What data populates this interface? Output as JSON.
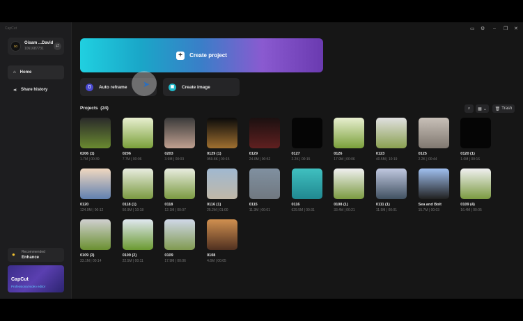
{
  "app": {
    "title": "CapCut"
  },
  "user": {
    "name": "Oisam ...David",
    "id": "1061687731"
  },
  "nav": [
    {
      "label": "Home",
      "icon": "home-icon"
    },
    {
      "label": "Share history",
      "icon": "share-icon"
    }
  ],
  "recommended": {
    "label": "Recommended",
    "item": "Enhance"
  },
  "promo": {
    "title": "CapCut",
    "subtitle": "Professional video editor"
  },
  "create_project": "Create project",
  "tools": [
    {
      "label": "Auto reframe",
      "color": "#4a4ad0"
    },
    {
      "label": "Create image",
      "color": "#20b8c8"
    }
  ],
  "projects": {
    "title": "Projects",
    "count": "(24)",
    "trash": "Trash"
  },
  "items": [
    {
      "t": "0206 (1)",
      "m": "1.7M | 00:39",
      "c1": "#2a2a2a",
      "c2": "#6a8a30"
    },
    {
      "t": "0206",
      "m": "7.7M | 00:06",
      "c1": "#e8efd0",
      "c2": "#7aa03a"
    },
    {
      "t": "0203",
      "m": "3.9M | 00:03",
      "c1": "#3a3a3a",
      "c2": "#c0a090"
    },
    {
      "t": "0129 (1)",
      "m": "959.8K | 00:15",
      "c1": "#0a0a0a",
      "c2": "#a07030"
    },
    {
      "t": "0129",
      "m": "24.0M | 00:52",
      "c1": "#1a1010",
      "c2": "#602020"
    },
    {
      "t": "0127",
      "m": "2.2K | 00:15",
      "c1": "#050505",
      "c2": "#050505"
    },
    {
      "t": "0126",
      "m": "17.9M | 00:06",
      "c1": "#e8efd0",
      "c2": "#7aa03a"
    },
    {
      "t": "0123",
      "m": "40.5M | 10:19",
      "c1": "#e0e0e0",
      "c2": "#8aa050"
    },
    {
      "t": "0125",
      "m": "2.2K | 00:44",
      "c1": "#c8c0b8",
      "c2": "#807870"
    },
    {
      "t": "0120 (1)",
      "m": "1.0M | 00:16",
      "c1": "#050505",
      "c2": "#050505"
    },
    {
      "t": "0120",
      "m": "124.9M | 00:12",
      "c1": "#f0d8c0",
      "c2": "#6080b0"
    },
    {
      "t": "0118 (1)",
      "m": "50.9M | 10:18",
      "c1": "#e8ecdf",
      "c2": "#7a9a40"
    },
    {
      "t": "0118",
      "m": "12.1M | 00:07",
      "c1": "#e8ecdf",
      "c2": "#7a9a40"
    },
    {
      "t": "0116 (1)",
      "m": "25.2M | 01:00",
      "c1": "#a0b8d0",
      "c2": "#c0b8a8"
    },
    {
      "t": "0115",
      "m": "11.3M | 00:01",
      "c1": "#8090a0",
      "c2": "#707880"
    },
    {
      "t": "0116",
      "m": "629.5M | 00:31",
      "c1": "#40c0c0",
      "c2": "#208890"
    },
    {
      "t": "0108 (1)",
      "m": "33.4M | 00:21",
      "c1": "#f0f0f0",
      "c2": "#7a9a40"
    },
    {
      "t": "0111 (1)",
      "m": "11.5M | 00:01",
      "c1": "#c0c8e0",
      "c2": "#405060"
    },
    {
      "t": "Sea and Bolt",
      "m": "15.7M | 00:03",
      "c1": "#a0c0f0",
      "c2": "#202020"
    },
    {
      "t": "0109 (4)",
      "m": "16.4M | 00:05",
      "c1": "#f0f0f0",
      "c2": "#7a9a40"
    },
    {
      "t": "0109 (3)",
      "m": "33.1M | 00:14",
      "c1": "#d0d0d0",
      "c2": "#6a9030"
    },
    {
      "t": "0109 (2)",
      "m": "22.5M | 00:11",
      "c1": "#e0e8f0",
      "c2": "#6a9a30"
    },
    {
      "t": "0109",
      "m": "17.9M | 00:06",
      "c1": "#d0d8e8",
      "c2": "#809a50"
    },
    {
      "t": "0108",
      "m": "4.6M | 00:05",
      "c1": "#d09050",
      "c2": "#503020"
    }
  ]
}
